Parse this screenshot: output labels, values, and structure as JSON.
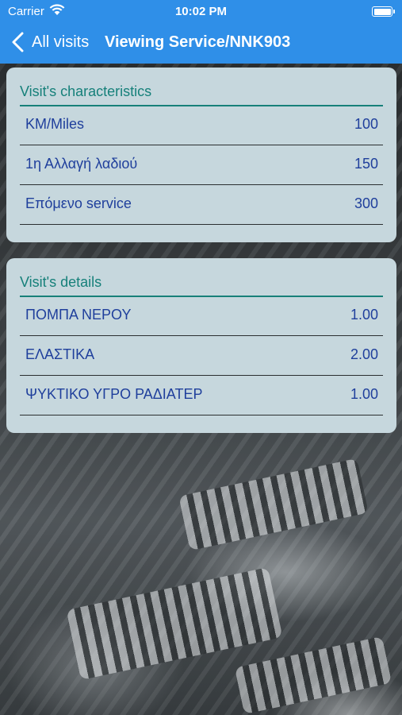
{
  "status_bar": {
    "carrier": "Carrier",
    "time": "10:02 PM",
    "icons": [
      "wifi-icon",
      "battery-icon"
    ]
  },
  "nav": {
    "back_label": "All visits",
    "title": "Viewing Service/NNK903",
    "color": "#2f8fe8"
  },
  "characteristics": {
    "header": "Visit's characteristics",
    "rows": [
      {
        "label": "KM/Miles",
        "value": "100"
      },
      {
        "label": "1η Αλλαγή λαδιού",
        "value": "150"
      },
      {
        "label": "Επόμενο service",
        "value": "300"
      }
    ]
  },
  "details": {
    "header": "Visit's details",
    "rows": [
      {
        "label": "ΠΟΜΠΑ ΝΕΡΟΥ",
        "value": "1.00"
      },
      {
        "label": "ΕΛΑΣΤΙΚΑ",
        "value": "2.00"
      },
      {
        "label": "ΨΥΚΤΙΚΟ ΥΓΡΟ ΡΑΔΙΑΤΕΡ",
        "value": "1.00"
      }
    ]
  }
}
